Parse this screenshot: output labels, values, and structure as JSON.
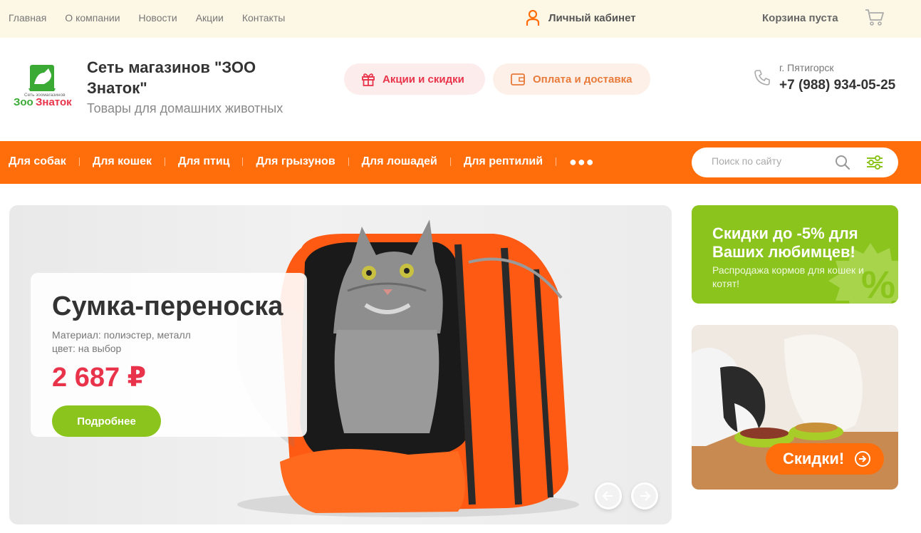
{
  "topnav": {
    "links": [
      "Главная",
      "О компании",
      "Новости",
      "Акции",
      "Контакты"
    ],
    "account_label": "Личный кабинет",
    "cart_label": "Корзина пуста"
  },
  "header": {
    "brand_title": "Сеть магазинов \"ЗОО Знаток\"",
    "brand_subtitle": "Товары для домашних животных",
    "logo_text": "ЗооЗнаток",
    "logo_small": "Сеть зоомагазинов",
    "promo_button": "Акции и скидки",
    "delivery_button": "Оплата и доставка",
    "city": "г. Пятигорск",
    "phone": "+7 (988) 934-05-25"
  },
  "categories": [
    "Для собак",
    "Для кошек",
    "Для птиц",
    "Для грызунов",
    "Для лошадей",
    "Для рептилий"
  ],
  "search": {
    "placeholder": "Поиск по сайту"
  },
  "hero": {
    "title": "Сумка-переноска",
    "line1": "Материал: полиэстер, металл",
    "line2": "цвет: на выбор",
    "price": "2 687 ₽",
    "button": "Подробнее"
  },
  "promo_green": {
    "title": "Скидки до -5% для Ваших любимцев!",
    "subtitle": "Распродажа кормов для кошек и котят!"
  },
  "promo_pets": {
    "button": "Скидки!"
  },
  "colors": {
    "accent_orange": "#ff6e0a",
    "accent_green": "#8ac41c",
    "price_red": "#e8334a",
    "topbar_bg": "#fdf8e6"
  }
}
